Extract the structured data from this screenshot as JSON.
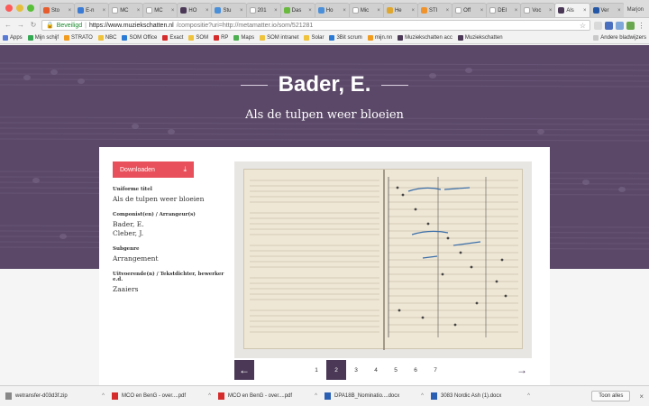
{
  "browser": {
    "tabs": [
      {
        "label": "Sto",
        "color": "#e65c2c"
      },
      {
        "label": "E-n",
        "color": "#3a7bd5"
      },
      {
        "label": "MC",
        "color": "#ffffff"
      },
      {
        "label": "MC",
        "color": "#ffffff"
      },
      {
        "label": "HO",
        "color": "#4a3856"
      },
      {
        "label": "Stu",
        "color": "#4a8fd9"
      },
      {
        "label": "201",
        "color": "#ffffff"
      },
      {
        "label": "Das",
        "color": "#69b93f"
      },
      {
        "label": "Ho",
        "color": "#4a8fd9"
      },
      {
        "label": "Mic",
        "color": "#ffffff"
      },
      {
        "label": "He",
        "color": "#e0a72e"
      },
      {
        "label": "STI",
        "color": "#f0932b"
      },
      {
        "label": "Off",
        "color": "#ffffff"
      },
      {
        "label": "DEI",
        "color": "#ffffff"
      },
      {
        "label": "Voc",
        "color": "#ffffff"
      },
      {
        "label": "Als",
        "color": "#4a3856",
        "active": true
      },
      {
        "label": "Ver",
        "color": "#2457a6"
      }
    ],
    "user_name": "Marjon",
    "address": {
      "secure_label": "Beveiligd",
      "url_host": "https://www.muziekschatten.nl",
      "url_path": "/compositie?uri=http://metamatter.io/som/521281"
    },
    "bookmarks": [
      {
        "label": "Apps",
        "color": "#5a7bd5"
      },
      {
        "label": "Mijn schijf",
        "color": "#34a853"
      },
      {
        "label": "STRATO",
        "color": "#f29c1f"
      },
      {
        "label": "NBC",
        "color": "#f0c33c"
      },
      {
        "label": "SOM Office",
        "color": "#2b7bd6"
      },
      {
        "label": "Exact",
        "color": "#d62b2b"
      },
      {
        "label": "SOM",
        "color": "#f0c33c"
      },
      {
        "label": "RP",
        "color": "#d62b2b"
      },
      {
        "label": "Maps",
        "color": "#4caf50"
      },
      {
        "label": "SOM intranet",
        "color": "#f0c33c"
      },
      {
        "label": "Solar",
        "color": "#f0c33c"
      },
      {
        "label": "3Bit scrum",
        "color": "#2b7bd6"
      },
      {
        "label": "mijn.nn",
        "color": "#f29c1f"
      },
      {
        "label": "Muziekschatten acc",
        "color": "#4a3856"
      },
      {
        "label": "Muziekschatten",
        "color": "#4a3856"
      }
    ],
    "other_bookmarks": "Andere bladwijzers"
  },
  "hero": {
    "title": "Bader, E.",
    "subtitle": "Als de tulpen weer bloeien"
  },
  "card": {
    "download_label": "Downloaden",
    "meta": [
      {
        "label": "Uniforme titel",
        "values": [
          "Als de tulpen weer bloeien"
        ]
      },
      {
        "label": "Componist(en) / Arrangeur(s)",
        "values": [
          "Bader, E.",
          "Cleber, J."
        ]
      },
      {
        "label": "Subgenre",
        "values": [
          "Arrangement"
        ]
      },
      {
        "label": "Uitvoerende(n) / Tekstdichter, bewerker e.d.",
        "values": [
          "Zaaiers"
        ]
      }
    ]
  },
  "pager": {
    "pages": [
      "1",
      "2",
      "3",
      "4",
      "5",
      "6",
      "7"
    ],
    "active": "2"
  },
  "downloads": {
    "items": [
      {
        "name": "wetransfer-d03d3f.zip",
        "color": "#888888"
      },
      {
        "name": "MCO en BenG - over....pdf",
        "color": "#d62b2b"
      },
      {
        "name": "MCO en BenG - over....pdf",
        "color": "#d62b2b"
      },
      {
        "name": "DPA18B_Nominatio....docx",
        "color": "#2b5fb4"
      },
      {
        "name": "3083 Nordic Ash (1).docx",
        "color": "#2b5fb4"
      }
    ],
    "show_all": "Toon alles"
  }
}
